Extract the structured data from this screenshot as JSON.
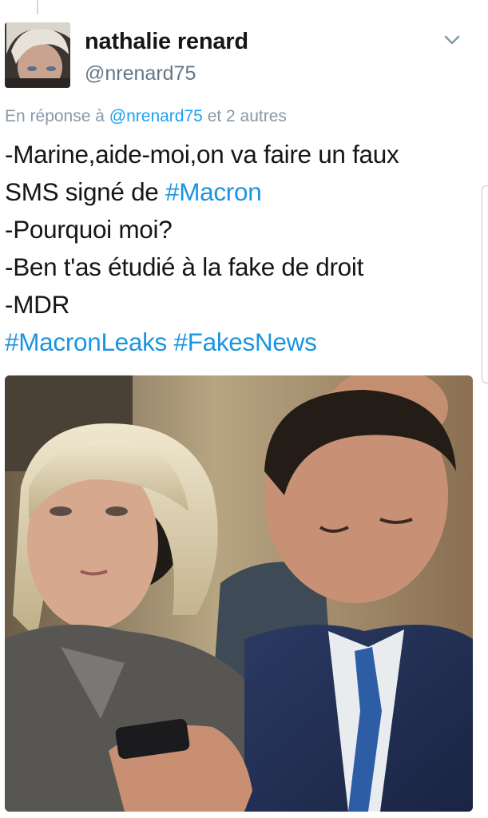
{
  "tweet": {
    "author_name": "nathalie renard",
    "author_handle": "@nrenard75",
    "reply_prefix": "En réponse à",
    "reply_mention": "@nrenard75",
    "reply_suffix": "et 2 autres",
    "lines": [
      {
        "text": "-Marine,aide-moi,on va faire un faux",
        "tag": ""
      },
      {
        "text": "SMS signé de ",
        "tag": "#Macron"
      },
      {
        "text": "-Pourquoi moi?",
        "tag": ""
      },
      {
        "text": "-Ben t'as étudié à la fake de droit",
        "tag": ""
      },
      {
        "text": "-MDR",
        "tag": ""
      }
    ],
    "hashtags": [
      "#MacronLeaks",
      "#FakesNews"
    ]
  },
  "icons": {
    "avatar": "profile-photo",
    "more": "chevron-down-icon",
    "media": "attached-photo"
  },
  "colors": {
    "text": "#14171a",
    "secondary": "#657786",
    "link": "#1b95e0"
  }
}
